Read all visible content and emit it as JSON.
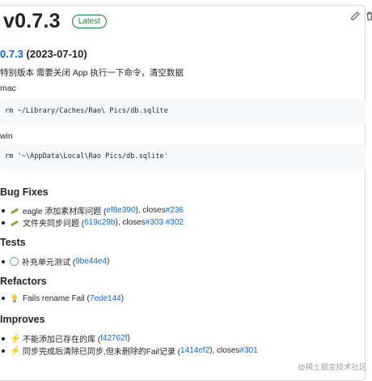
{
  "release": {
    "title": "v0.7.3",
    "badge": "Latest"
  },
  "version_line": {
    "link": "0.7.3",
    "date": " (2023-07-10)"
  },
  "intro": "特别版本 需要关闭 App 执行一下命令，清空数据",
  "mac": {
    "label": "mac",
    "command": "rm ~/Library/Caches/Rao\\ Pics/db.sqlite"
  },
  "win": {
    "label": "win",
    "command": "rm '~\\AppData\\Local\\Rao Pics/db.sqlite'"
  },
  "sections": {
    "bug_fixes": {
      "title": "Bug Fixes",
      "items": [
        {
          "emoji": "bug-icon",
          "text": "eagle 添加素材库问题 (",
          "link": "ef8e390",
          "mid": "), closes ",
          "refs": [
            "#236"
          ]
        },
        {
          "emoji": "bug-icon",
          "text": "文件夹同步问题 (",
          "link": "619c29b",
          "mid": "), closes ",
          "refs": [
            "#303",
            "#302"
          ]
        }
      ]
    },
    "tests": {
      "title": "Tests",
      "items": [
        {
          "emoji": "ring-icon",
          "text": "补充单元测试 (",
          "link": "9be44e4",
          "tail": ")"
        }
      ]
    },
    "refactors": {
      "title": "Refactors",
      "items": [
        {
          "emoji": "bulb-icon",
          "text": "Fails rename Fail (",
          "link": "7ede144",
          "tail": ")"
        }
      ]
    },
    "improves": {
      "title": "Improves",
      "items": [
        {
          "emoji": "zap-icon",
          "text": "不能添加已存在的库 (",
          "link": "f42762f",
          "tail": ")"
        },
        {
          "emoji": "zap-icon",
          "text": "同步完成后清除已同步,但未删除的Fail记录 (",
          "link": "1414ef2",
          "mid": "), closes ",
          "refs": [
            "#301"
          ]
        }
      ]
    }
  },
  "watermark": "@稀土掘金技术社区",
  "colors": {
    "link": "#0969da",
    "badge": "#1a7f37",
    "code_bg": "#f6f8fa"
  }
}
